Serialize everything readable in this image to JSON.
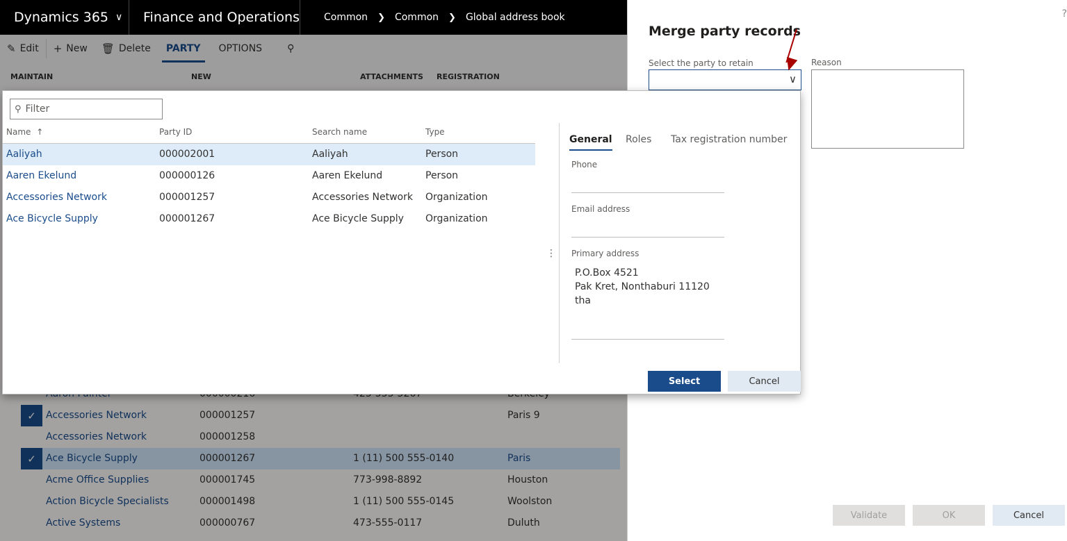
{
  "navbar": {
    "app_name": "Dynamics 365",
    "module": "Finance and Operations",
    "breadcrumb": [
      "Common",
      "Common",
      "Global address book"
    ]
  },
  "actionpane": {
    "edit": "Edit",
    "new": "New",
    "delete": "Delete",
    "tabs": [
      "PARTY",
      "OPTIONS"
    ],
    "groups": [
      "MAINTAIN",
      "NEW",
      "ATTACHMENTS",
      "REGISTRATION"
    ]
  },
  "background_grid": {
    "rows": [
      {
        "name": "Aaron Painter",
        "party_id": "000000216",
        "phone": "425-555-5267",
        "city": "Berkeley",
        "checked": false,
        "selected": false
      },
      {
        "name": "Accessories Network",
        "party_id": "000001257",
        "phone": "",
        "city": "Paris 9",
        "checked": true,
        "selected": false
      },
      {
        "name": "Accessories Network",
        "party_id": "000001258",
        "phone": "",
        "city": "",
        "checked": false,
        "selected": false
      },
      {
        "name": "Ace Bicycle Supply",
        "party_id": "000001267",
        "phone": "1 (11) 500 555-0140",
        "city": "Paris",
        "checked": true,
        "selected": true
      },
      {
        "name": "Acme Office Supplies",
        "party_id": "000001745",
        "phone": "773-998-8892",
        "city": "Houston",
        "checked": false,
        "selected": false
      },
      {
        "name": "Action Bicycle Specialists",
        "party_id": "000001498",
        "phone": "1 (11) 500 555-0145",
        "city": "Woolston",
        "checked": false,
        "selected": false
      },
      {
        "name": "Active Systems",
        "party_id": "000000767",
        "phone": "473-555-0117",
        "city": "Duluth",
        "checked": false,
        "selected": false
      }
    ]
  },
  "merge_panel": {
    "title": "Merge party records",
    "retain_label": "Select the party to retain",
    "reason_label": "Reason",
    "help": "?",
    "buttons": {
      "validate": "Validate",
      "ok": "OK",
      "cancel": "Cancel"
    }
  },
  "lookup": {
    "filter_placeholder": "Filter",
    "columns": {
      "name": "Name",
      "party_id": "Party ID",
      "search_name": "Search name",
      "type": "Type"
    },
    "rows": [
      {
        "name": "Aaliyah",
        "party_id": "000002001",
        "search_name": "Aaliyah",
        "type": "Person"
      },
      {
        "name": "Aaren Ekelund",
        "party_id": "000000126",
        "search_name": "Aaren Ekelund",
        "type": "Person"
      },
      {
        "name": "Accessories Network",
        "party_id": "000001257",
        "search_name": "Accessories Network",
        "type": "Organization"
      },
      {
        "name": "Ace Bicycle Supply",
        "party_id": "000001267",
        "search_name": "Ace Bicycle Supply",
        "type": "Organization"
      }
    ],
    "tabs": [
      "General",
      "Roles",
      "Tax registration number"
    ],
    "preview": {
      "phone_label": "Phone",
      "email_label": "Email address",
      "address_label": "Primary address",
      "address_lines": [
        "P.O.Box 4521",
        "Pak Kret, Nonthaburi 11120",
        "tha"
      ]
    },
    "buttons": {
      "select": "Select",
      "cancel": "Cancel"
    }
  },
  "colors": {
    "accent": "#1a4c8b",
    "nav_bg": "#000000",
    "arrow": "#a80000"
  }
}
